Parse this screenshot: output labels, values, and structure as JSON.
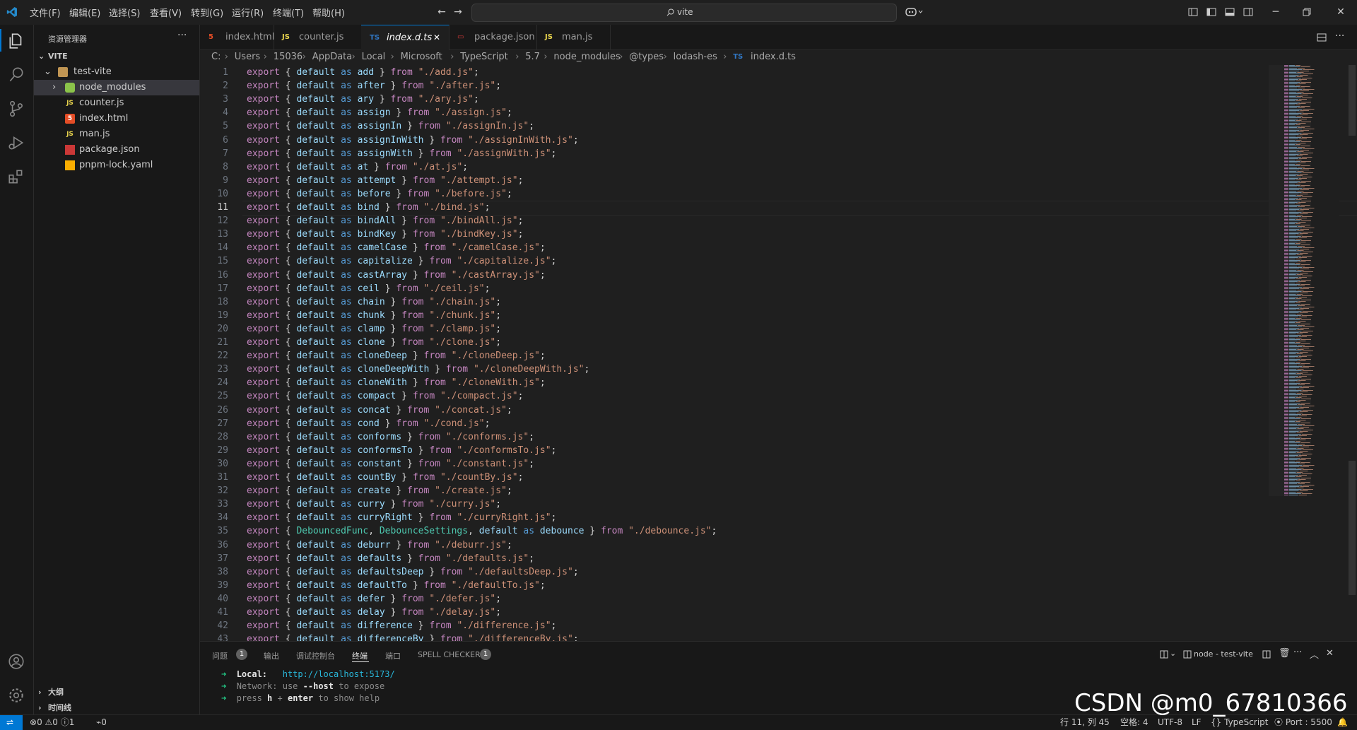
{
  "menu": [
    "文件(F)",
    "编辑(E)",
    "选择(S)",
    "查看(V)",
    "转到(G)",
    "运行(R)",
    "终端(T)",
    "帮助(H)"
  ],
  "command_center": "vite",
  "sidebar": {
    "title": "资源管理器",
    "root": "VITE",
    "folder": "test-vite",
    "items": [
      {
        "label": "node_modules",
        "icon": "node-folder-icon"
      },
      {
        "label": "counter.js",
        "icon": "js-icon"
      },
      {
        "label": "index.html",
        "icon": "html-icon"
      },
      {
        "label": "man.js",
        "icon": "js-icon"
      },
      {
        "label": "package.json",
        "icon": "npm-icon"
      },
      {
        "label": "pnpm-lock.yaml",
        "icon": "pnpm-icon"
      }
    ],
    "outline": "大纲",
    "timeline": "时间线"
  },
  "tabs": [
    {
      "label": "index.html",
      "icon": "html-icon"
    },
    {
      "label": "counter.js",
      "icon": "JS"
    },
    {
      "label": "index.d.ts",
      "icon": "TS"
    },
    {
      "label": "package.json",
      "icon": "npm-icon"
    },
    {
      "label": "man.js",
      "icon": "JS"
    }
  ],
  "breadcrumb": [
    "C:",
    "Users",
    "15036",
    "AppData",
    "Local",
    "Microsoft",
    "TypeScript",
    "5.7",
    "node_modules",
    "@types",
    "lodash-es",
    "TS",
    "index.d.ts"
  ],
  "current_line": 11,
  "code_lines": [
    [
      "add",
      "./add.js"
    ],
    [
      "after",
      "./after.js"
    ],
    [
      "ary",
      "./ary.js"
    ],
    [
      "assign",
      "./assign.js"
    ],
    [
      "assignIn",
      "./assignIn.js"
    ],
    [
      "assignInWith",
      "./assignInWith.js"
    ],
    [
      "assignWith",
      "./assignWith.js"
    ],
    [
      "at",
      "./at.js"
    ],
    [
      "attempt",
      "./attempt.js"
    ],
    [
      "before",
      "./before.js"
    ],
    [
      "bind",
      "./bind.js"
    ],
    [
      "bindAll",
      "./bindAll.js"
    ],
    [
      "bindKey",
      "./bindKey.js"
    ],
    [
      "camelCase",
      "./camelCase.js"
    ],
    [
      "capitalize",
      "./capitalize.js"
    ],
    [
      "castArray",
      "./castArray.js"
    ],
    [
      "ceil",
      "./ceil.js"
    ],
    [
      "chain",
      "./chain.js"
    ],
    [
      "chunk",
      "./chunk.js"
    ],
    [
      "clamp",
      "./clamp.js"
    ],
    [
      "clone",
      "./clone.js"
    ],
    [
      "cloneDeep",
      "./cloneDeep.js"
    ],
    [
      "cloneDeepWith",
      "./cloneDeepWith.js"
    ],
    [
      "cloneWith",
      "./cloneWith.js"
    ],
    [
      "compact",
      "./compact.js"
    ],
    [
      "concat",
      "./concat.js"
    ],
    [
      "cond",
      "./cond.js"
    ],
    [
      "conforms",
      "./conforms.js"
    ],
    [
      "conformsTo",
      "./conformsTo.js"
    ],
    [
      "constant",
      "./constant.js"
    ],
    [
      "countBy",
      "./countBy.js"
    ],
    [
      "create",
      "./create.js"
    ],
    [
      "curry",
      "./curry.js"
    ],
    [
      "curryRight",
      "./curryRight.js"
    ],
    [
      "debounce",
      "./debounce.js"
    ],
    [
      "deburr",
      "./deburr.js"
    ],
    [
      "defaults",
      "./defaults.js"
    ],
    [
      "defaultsDeep",
      "./defaultsDeep.js"
    ],
    [
      "defaultTo",
      "./defaultTo.js"
    ],
    [
      "defer",
      "./defer.js"
    ],
    [
      "delay",
      "./delay.js"
    ],
    [
      "difference",
      "./difference.js"
    ],
    [
      "differenceBy",
      "./differenceBy.js"
    ]
  ],
  "debounce_types": [
    "DebouncedFunc",
    "DebounceSettings"
  ],
  "keywords": {
    "export": "export",
    "default": "default",
    "as": "as",
    "from": "from"
  },
  "panel": {
    "tabs": [
      "问题",
      "输出",
      "调试控制台",
      "终端",
      "端口",
      "SPELL CHECKER"
    ],
    "problems_count": "1",
    "spell_count": "1",
    "terminal_name": "node - test-vite",
    "terminal": {
      "local_label": "Local:",
      "local_url": "http://localhost:5173/",
      "network_label": "Network:",
      "network_text_1": "use",
      "network_host": "--host",
      "network_text_2": "to expose",
      "press_text_1": "press",
      "press_h": "h",
      "press_plus": "+",
      "press_enter": "enter",
      "press_text_2": "to show help"
    }
  },
  "status": {
    "errors": "0",
    "warnings": "0",
    "info": "1",
    "ports": "0",
    "position": "行 11, 列 45",
    "spaces": "空格: 4",
    "encoding": "UTF-8",
    "eol": "LF",
    "language": "TypeScript",
    "port": "Port : 5500"
  },
  "watermark": "CSDN @m0_67810366",
  "colors": {
    "accent": "#0078d4",
    "keyword": "#c586c0",
    "default": "#569cd6",
    "identifier": "#9cdcfe",
    "string": "#ce9178",
    "type": "#4ec9b0"
  }
}
